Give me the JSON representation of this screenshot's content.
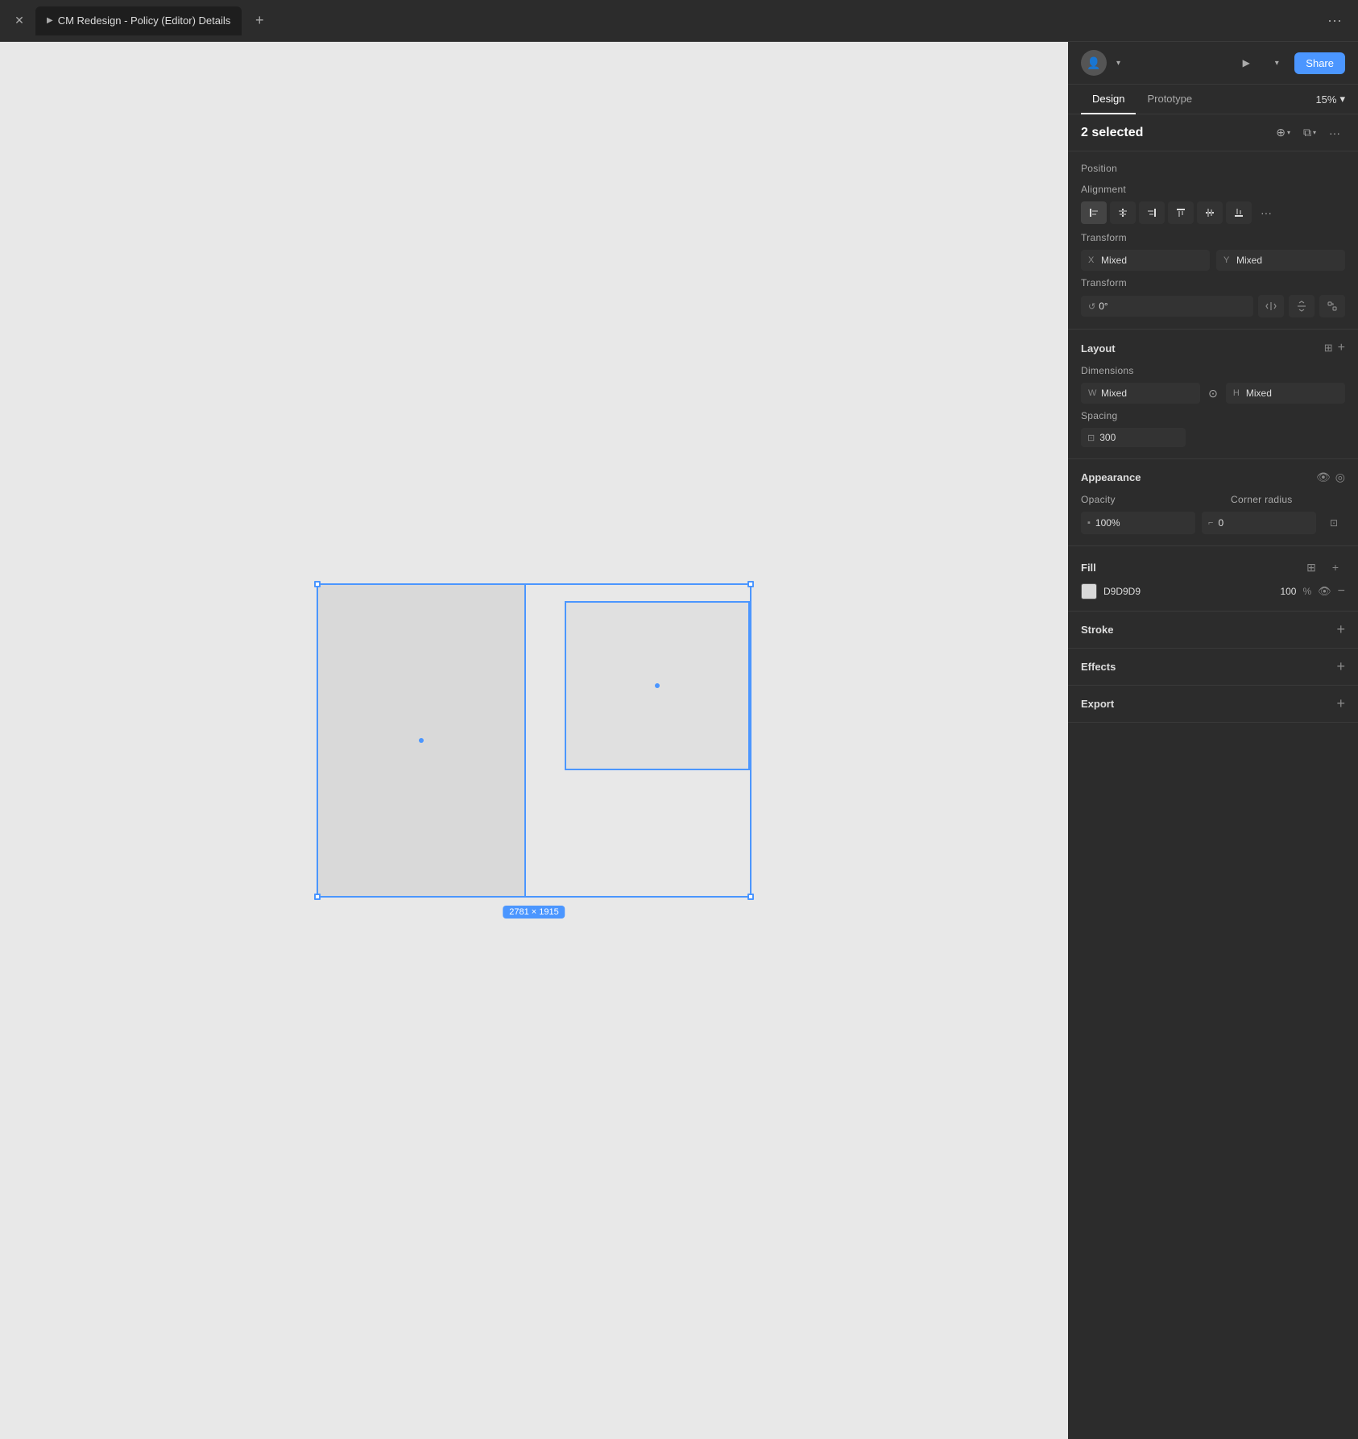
{
  "topbar": {
    "close_label": "×",
    "tab_title": "CM Redesign - Policy (Editor) Details",
    "new_tab": "+",
    "more": "···"
  },
  "header": {
    "avatar_label": "👤",
    "play_label": "▶",
    "share_label": "Share"
  },
  "tabs": {
    "design_label": "Design",
    "prototype_label": "Prototype",
    "zoom_label": "15%"
  },
  "selection": {
    "count_label": "2 selected",
    "align_icon": "⊕",
    "copy_icon": "⧉",
    "more_icon": "···"
  },
  "position": {
    "title": "Position",
    "alignment_label": "Alignment",
    "x_label": "X",
    "x_value": "Mixed",
    "y_label": "Y",
    "y_value": "Mixed",
    "transform_label": "Transform",
    "rotation_value": "0°"
  },
  "layout": {
    "title": "Layout",
    "dimensions_label": "Dimensions",
    "w_label": "W",
    "w_value": "Mixed",
    "h_label": "H",
    "h_value": "Mixed",
    "spacing_label": "Spacing",
    "spacing_value": "300"
  },
  "appearance": {
    "title": "Appearance",
    "opacity_label": "Opacity",
    "opacity_value": "100%",
    "corner_label": "Corner radius",
    "corner_value": "0"
  },
  "fill": {
    "title": "Fill",
    "color_hex": "D9D9D9",
    "color_value": "#D9D9D9",
    "opacity_value": "100",
    "percent_label": "%"
  },
  "stroke": {
    "title": "Stroke"
  },
  "effects": {
    "title": "Effects"
  },
  "export": {
    "title": "Export"
  },
  "canvas": {
    "dim_label": "2781 × 1915"
  },
  "alignment_buttons": [
    {
      "icon": "⬛",
      "title": "align-left"
    },
    {
      "icon": "⬛",
      "title": "align-center-h"
    },
    {
      "icon": "⬛",
      "title": "align-right"
    },
    {
      "icon": "⬛",
      "title": "align-top"
    },
    {
      "icon": "⬛",
      "title": "align-center-v"
    },
    {
      "icon": "⬛",
      "title": "align-bottom"
    },
    {
      "icon": "···",
      "title": "more-align"
    }
  ]
}
